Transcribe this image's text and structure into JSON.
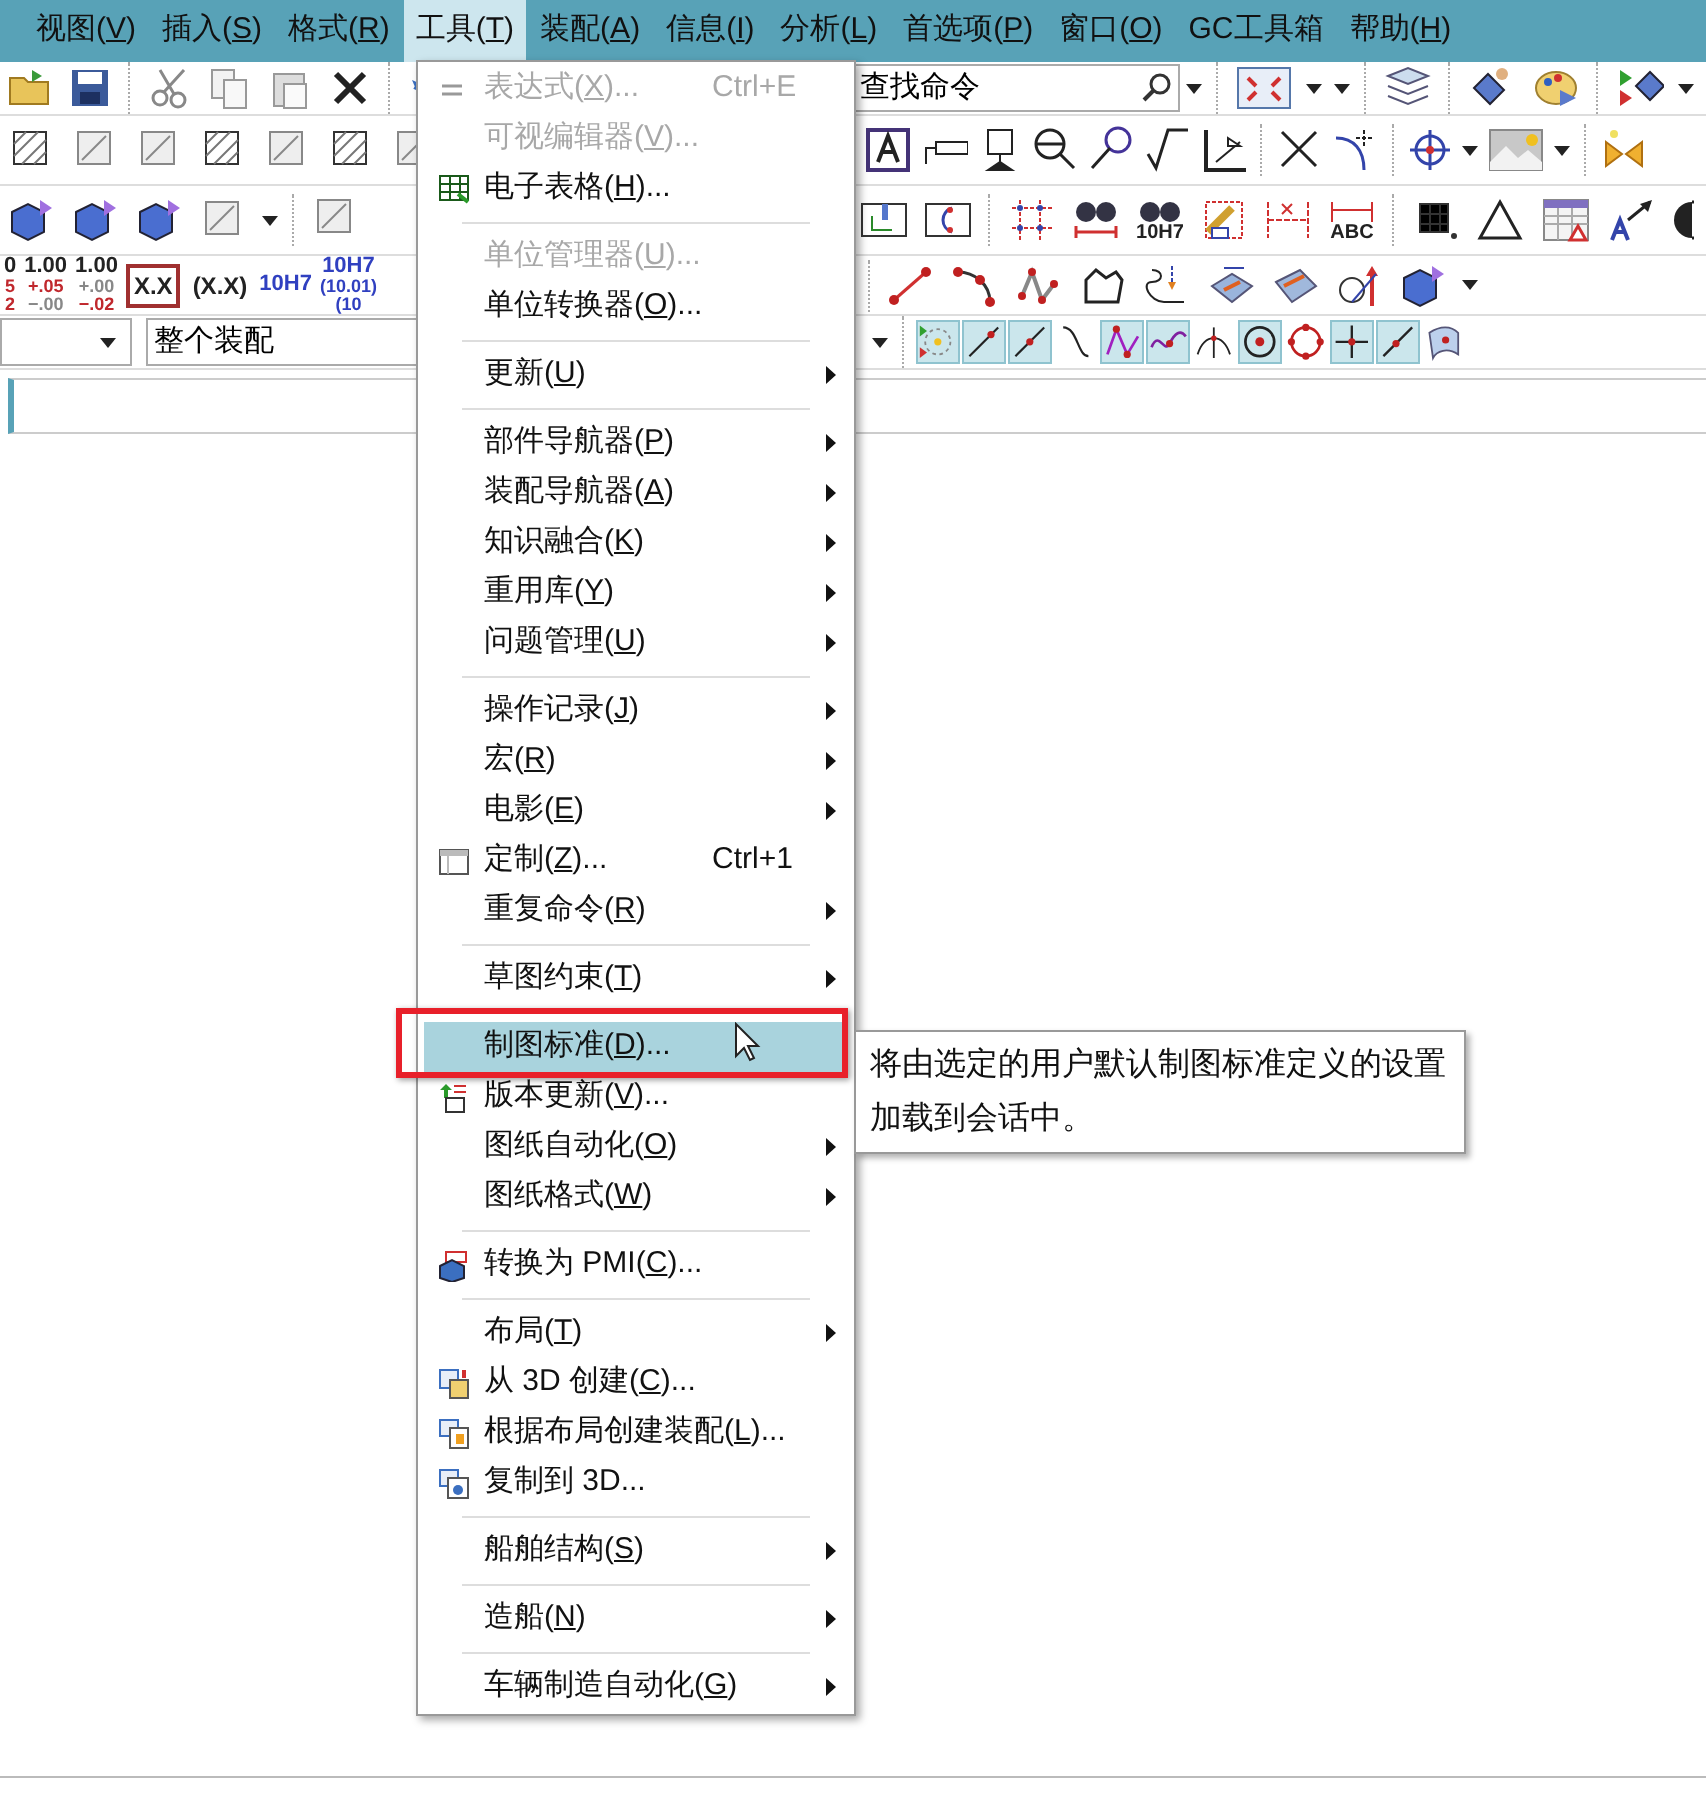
{
  "menu_bar": [
    {
      "label": "视图(V)",
      "selected": false
    },
    {
      "label": "插入(S)",
      "selected": false
    },
    {
      "label": "格式(R)",
      "selected": false
    },
    {
      "label": "工具(T)",
      "selected": true
    },
    {
      "label": "装配(A)",
      "selected": false
    },
    {
      "label": "信息(I)",
      "selected": false
    },
    {
      "label": "分析(L)",
      "selected": false
    },
    {
      "label": "首选项(P)",
      "selected": false
    },
    {
      "label": "窗口(O)",
      "selected": false
    },
    {
      "label": "GC工具箱",
      "selected": false
    },
    {
      "label": "帮助(H)",
      "selected": false
    }
  ],
  "toolbar": {
    "search": {
      "value": "查找命令"
    },
    "dimension_styles": [
      {
        "lines": [
          {
            "text": "0",
            "color": "#222222"
          },
          {
            "text": "5",
            "color": "#c0282d"
          },
          {
            "text": "2",
            "color": "#c0282d"
          }
        ]
      },
      {
        "lines": [
          {
            "text": "1.00",
            "color": "#222222"
          },
          {
            "text": "+.05",
            "color": "#c0282d"
          },
          {
            "text": "−.00",
            "color": "#888888"
          }
        ]
      },
      {
        "lines": [
          {
            "text": "1.00",
            "color": "#222222"
          },
          {
            "text": "+.00",
            "color": "#888888"
          },
          {
            "text": "−.02",
            "color": "#c0282d"
          }
        ]
      },
      {
        "lines": [
          {
            "text": "X.X",
            "color": "#222222"
          }
        ],
        "boxed": true
      },
      {
        "lines": [
          {
            "text": "(X.X)",
            "color": "#222222"
          }
        ],
        "boxed": false
      },
      {
        "lines": [
          {
            "text": "10H7",
            "color": "#3040c0"
          }
        ]
      },
      {
        "lines": [
          {
            "text": "10H7",
            "color": "#3040c0"
          },
          {
            "text": "(10.01)",
            "color": "#3040c0"
          },
          {
            "text": "(10",
            "color": "#3040c0"
          }
        ]
      }
    ],
    "icon_captions": [
      "10H7",
      "ABC"
    ],
    "scope": {
      "value": "整个装配"
    },
    "snap_buttons": [
      {
        "pressed": true
      },
      {
        "pressed": true
      },
      {
        "pressed": true
      },
      {
        "pressed": false
      },
      {
        "pressed": true
      },
      {
        "pressed": true
      },
      {
        "pressed": false
      },
      {
        "pressed": true
      },
      {
        "pressed": false
      },
      {
        "pressed": true
      },
      {
        "pressed": true
      },
      {
        "pressed": false
      }
    ]
  },
  "menu": {
    "items": [
      {
        "kind": "command",
        "label": "表达式(X)...",
        "shortcut": "Ctrl+E",
        "disabled": true,
        "icon": true,
        "submenu": false,
        "selected": false,
        "boxed": false
      },
      {
        "kind": "command",
        "label": "可视编辑器(V)...",
        "disabled": true,
        "icon": false,
        "submenu": false,
        "selected": false,
        "boxed": false
      },
      {
        "kind": "command",
        "label": "电子表格(H)...",
        "disabled": false,
        "icon": true,
        "submenu": false,
        "selected": false,
        "boxed": false
      },
      {
        "kind": "separator"
      },
      {
        "kind": "command",
        "label": "单位管理器(U)...",
        "disabled": true,
        "icon": false,
        "submenu": false,
        "selected": false,
        "boxed": false
      },
      {
        "kind": "command",
        "label": "单位转换器(O)...",
        "disabled": false,
        "icon": false,
        "submenu": false,
        "selected": false,
        "boxed": false
      },
      {
        "kind": "separator"
      },
      {
        "kind": "command",
        "label": "更新(U)",
        "disabled": false,
        "icon": false,
        "submenu": true,
        "selected": false,
        "boxed": false
      },
      {
        "kind": "separator"
      },
      {
        "kind": "command",
        "label": "部件导航器(P)",
        "disabled": false,
        "icon": false,
        "submenu": true,
        "selected": false,
        "boxed": false
      },
      {
        "kind": "command",
        "label": "装配导航器(A)",
        "disabled": false,
        "icon": false,
        "submenu": true,
        "selected": false,
        "boxed": false
      },
      {
        "kind": "command",
        "label": "知识融合(K)",
        "disabled": false,
        "icon": false,
        "submenu": true,
        "selected": false,
        "boxed": false
      },
      {
        "kind": "command",
        "label": "重用库(Y)",
        "disabled": false,
        "icon": false,
        "submenu": true,
        "selected": false,
        "boxed": false
      },
      {
        "kind": "command",
        "label": "问题管理(U)",
        "disabled": false,
        "icon": false,
        "submenu": true,
        "selected": false,
        "boxed": false
      },
      {
        "kind": "separator"
      },
      {
        "kind": "command",
        "label": "操作记录(J)",
        "disabled": false,
        "icon": false,
        "submenu": true,
        "selected": false,
        "boxed": false
      },
      {
        "kind": "command",
        "label": "宏(R)",
        "disabled": false,
        "icon": false,
        "submenu": true,
        "selected": false,
        "boxed": false
      },
      {
        "kind": "command",
        "label": "电影(E)",
        "disabled": false,
        "icon": false,
        "submenu": true,
        "selected": false,
        "boxed": false
      },
      {
        "kind": "command",
        "label": "定制(Z)...",
        "shortcut": "Ctrl+1",
        "disabled": false,
        "icon": true,
        "submenu": false,
        "selected": false,
        "boxed": false
      },
      {
        "kind": "command",
        "label": "重复命令(R)",
        "disabled": false,
        "icon": false,
        "submenu": true,
        "selected": false,
        "boxed": false
      },
      {
        "kind": "separator"
      },
      {
        "kind": "command",
        "label": "草图约束(T)",
        "disabled": false,
        "icon": false,
        "submenu": true,
        "selected": false,
        "boxed": false
      },
      {
        "kind": "separator"
      },
      {
        "kind": "command",
        "label": "制图标准(D)...",
        "disabled": false,
        "icon": false,
        "submenu": false,
        "selected": true,
        "boxed": true
      },
      {
        "kind": "command",
        "label": "版本更新(V)...",
        "disabled": false,
        "icon": true,
        "submenu": false,
        "selected": false,
        "boxed": false
      },
      {
        "kind": "command",
        "label": "图纸自动化(O)",
        "disabled": false,
        "icon": false,
        "submenu": true,
        "selected": false,
        "boxed": false
      },
      {
        "kind": "command",
        "label": "图纸格式(W)",
        "disabled": false,
        "icon": false,
        "submenu": true,
        "selected": false,
        "boxed": false
      },
      {
        "kind": "separator"
      },
      {
        "kind": "command",
        "label": "转换为 PMI(C)...",
        "disabled": false,
        "icon": true,
        "submenu": false,
        "selected": false,
        "boxed": false
      },
      {
        "kind": "separator"
      },
      {
        "kind": "command",
        "label": "布局(T)",
        "disabled": false,
        "icon": false,
        "submenu": true,
        "selected": false,
        "boxed": false
      },
      {
        "kind": "command",
        "label": "从 3D 创建(C)...",
        "disabled": false,
        "icon": true,
        "submenu": false,
        "selected": false,
        "boxed": false
      },
      {
        "kind": "command",
        "label": "根据布局创建装配(L)...",
        "disabled": false,
        "icon": true,
        "submenu": false,
        "selected": false,
        "boxed": false
      },
      {
        "kind": "command",
        "label": "复制到 3D...",
        "disabled": false,
        "icon": true,
        "submenu": false,
        "selected": false,
        "boxed": false
      },
      {
        "kind": "separator"
      },
      {
        "kind": "command",
        "label": "船舶结构(S)",
        "disabled": false,
        "icon": false,
        "submenu": true,
        "selected": false,
        "boxed": false
      },
      {
        "kind": "separator"
      },
      {
        "kind": "command",
        "label": "造船(N)",
        "disabled": false,
        "icon": false,
        "submenu": true,
        "selected": false,
        "boxed": false
      },
      {
        "kind": "separator"
      },
      {
        "kind": "command",
        "label": "车辆制造自动化(G)",
        "disabled": false,
        "icon": false,
        "submenu": true,
        "selected": false,
        "boxed": false
      }
    ]
  },
  "tooltip": "将由选定的用户默认制图标准定义的设置加载到会话中。"
}
